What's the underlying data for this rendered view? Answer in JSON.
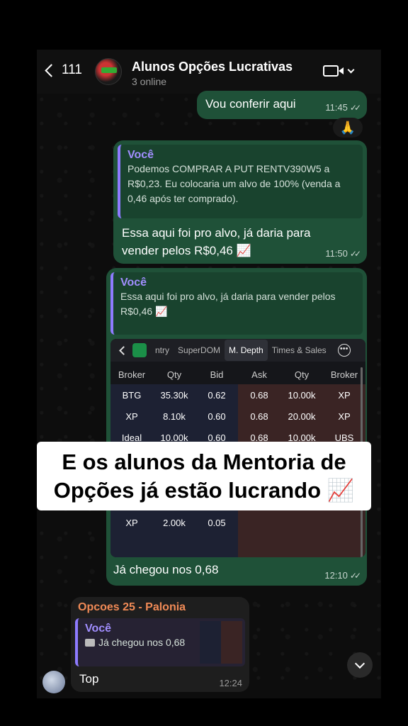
{
  "header": {
    "back_count": "111",
    "title": "Alunos Opções Lucrativas",
    "subtitle": "3 online"
  },
  "messages": {
    "m1": {
      "text": "Vou conferir aqui",
      "time": "11:45",
      "reaction": "🙏"
    },
    "m2": {
      "quote_author": "Você",
      "quote_text": "Podemos COMPRAR A PUT RENTV390W5 a R$0,23. Eu colocaria um alvo de 100% (venda a 0,46 após ter comprado).",
      "text": "Essa aqui foi pro alvo, já daria para vender pelos R$0,46 📈",
      "time": "11:50"
    },
    "m3": {
      "quote_author": "Você",
      "quote_text": "Essa aqui foi pro alvo, já daria para vender pelos R$0,46 📈",
      "text": "Já chegou nos 0,68",
      "time": "12:10"
    },
    "m4": {
      "sender": "Opcoes 25 - Palonia",
      "quote_author": "Você",
      "quote_text": "Já chegou nos 0,68",
      "text": "Top",
      "time": "12:24"
    }
  },
  "screenshot": {
    "tabs": [
      "ntry",
      "SuperDOM",
      "M. Depth",
      "Times & Sales"
    ],
    "headers": [
      "Broker",
      "Qty",
      "Bid",
      "Ask",
      "Qty",
      "Broker"
    ],
    "rows": [
      [
        "BTG",
        "35.30k",
        "0.62",
        "0.68",
        "10.00k",
        "XP"
      ],
      [
        "XP",
        "8.10k",
        "0.60",
        "0.68",
        "20.00k",
        "XP"
      ],
      [
        "Ideal",
        "10.00k",
        "0.60",
        "0.68",
        "10.00k",
        "UBS"
      ],
      [
        "",
        "",
        "",
        "",
        "",
        ""
      ],
      [
        "",
        "",
        "",
        "",
        "",
        ""
      ],
      [
        "",
        "",
        "",
        "",
        "",
        ""
      ],
      [
        "XP",
        "2.00k",
        "0.05",
        "",
        "",
        ""
      ]
    ]
  },
  "overlay": {
    "line1": "E os alunos da Mentoria de",
    "line2": "Opções já estão lucrando 📈"
  },
  "colors": {
    "bubble": "#1f5138",
    "quote_name": "#a18eff",
    "sender_name": "#f08a56"
  }
}
